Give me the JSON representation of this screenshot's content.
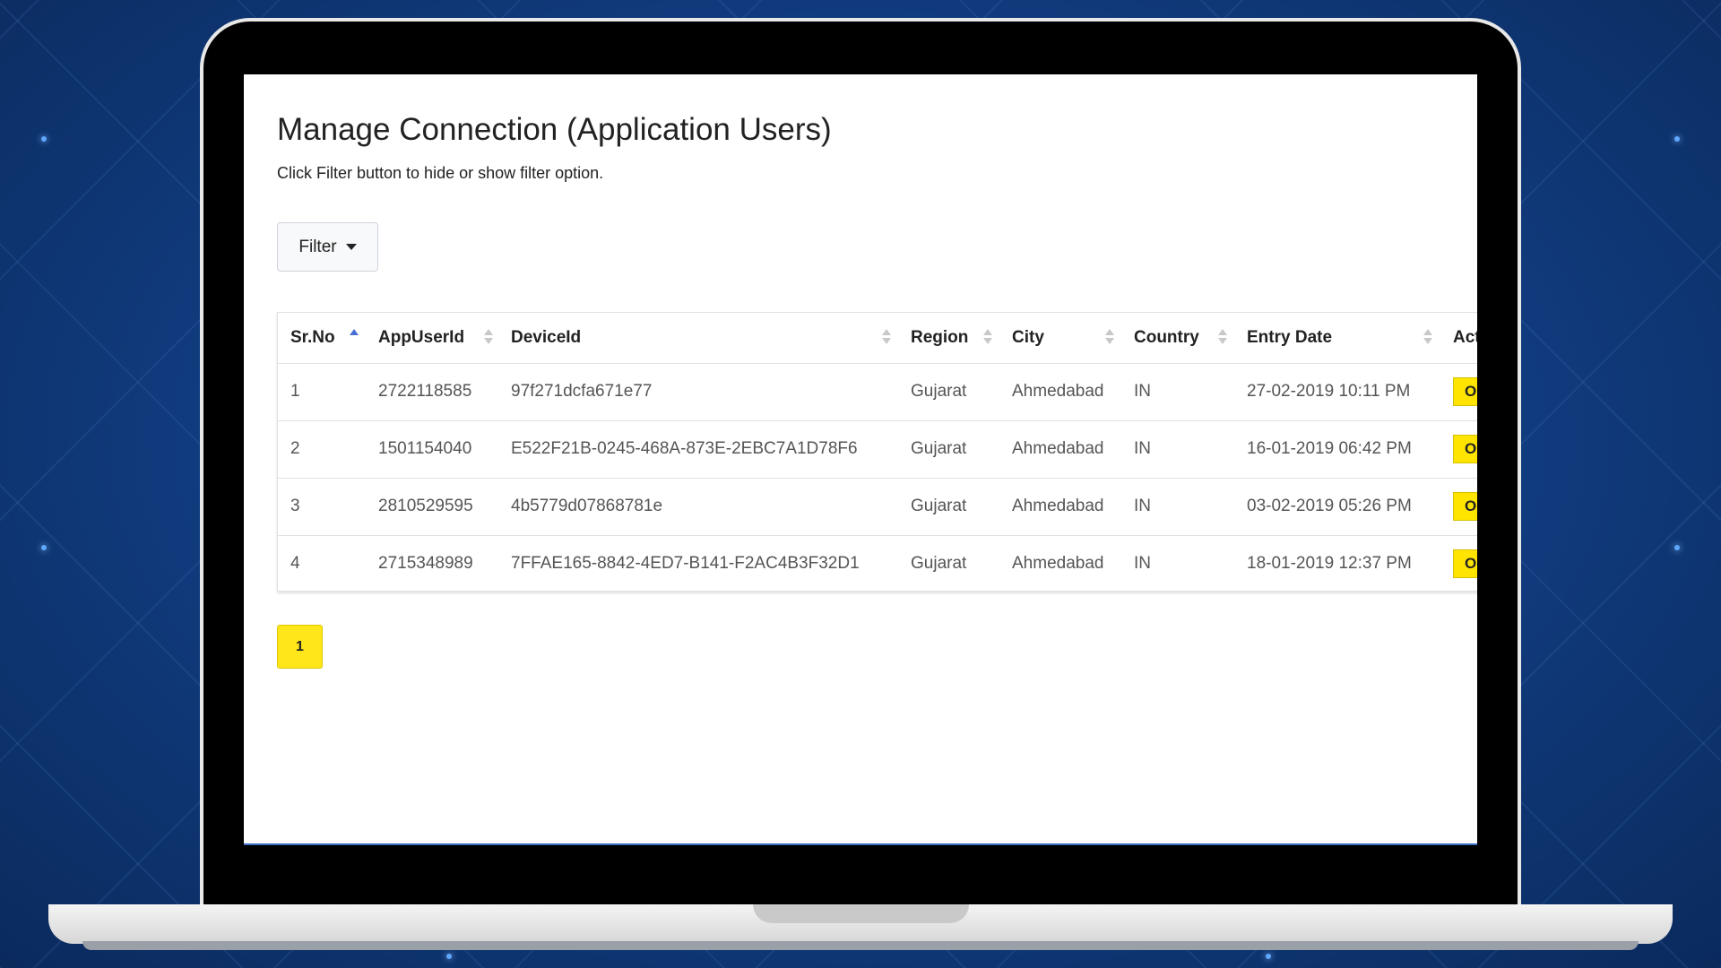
{
  "page": {
    "title": "Manage Connection (Application Users)",
    "subtitle": "Click Filter button to hide or show filter option."
  },
  "filter": {
    "label": "Filter"
  },
  "table": {
    "columns": [
      "Sr.No",
      "AppUserId",
      "DeviceId",
      "Region",
      "City",
      "Country",
      "Entry Date",
      "Act"
    ],
    "rows": [
      {
        "srno": "1",
        "appuserid": "2722118585",
        "deviceid": "97f271dcfa671e77",
        "region": "Gujarat",
        "city": "Ahmedabad",
        "country": "IN",
        "entry_date": "27-02-2019 10:11 PM",
        "action": "O"
      },
      {
        "srno": "2",
        "appuserid": "1501154040",
        "deviceid": "E522F21B-0245-468A-873E-2EBC7A1D78F6",
        "region": "Gujarat",
        "city": "Ahmedabad",
        "country": "IN",
        "entry_date": "16-01-2019 06:42 PM",
        "action": "O"
      },
      {
        "srno": "3",
        "appuserid": "2810529595",
        "deviceid": "4b5779d07868781e",
        "region": "Gujarat",
        "city": "Ahmedabad",
        "country": "IN",
        "entry_date": "03-02-2019 05:26 PM",
        "action": "O"
      },
      {
        "srno": "4",
        "appuserid": "2715348989",
        "deviceid": "7FFAE165-8842-4ED7-B141-F2AC4B3F32D1",
        "region": "Gujarat",
        "city": "Ahmedabad",
        "country": "IN",
        "entry_date": "18-01-2019 12:37 PM",
        "action": "O"
      }
    ]
  },
  "pagination": {
    "current": "1"
  },
  "colors": {
    "accent": "#ffe400",
    "sort_active": "#4a6fd4",
    "background": "#123f85"
  }
}
